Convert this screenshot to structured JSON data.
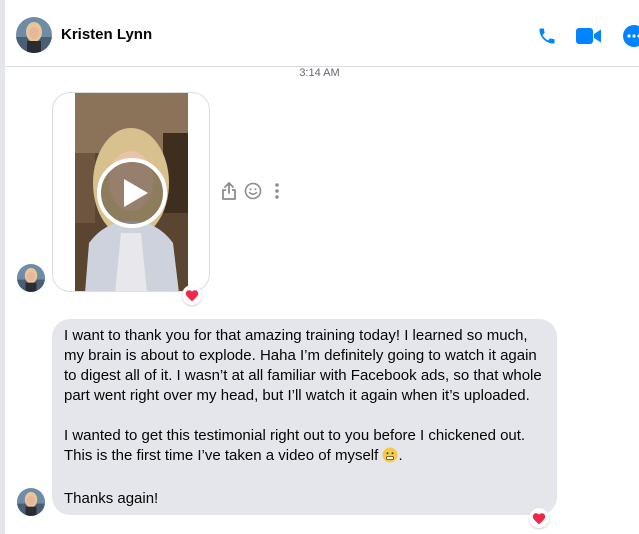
{
  "contact": {
    "name": "Kristen Lynn"
  },
  "header": {
    "actions": [
      {
        "name": "phone-icon"
      },
      {
        "name": "video-camera-icon"
      },
      {
        "name": "more-options-icon"
      }
    ]
  },
  "conversation": {
    "timestamp": "3:14 AM",
    "video_message": {
      "reaction": "heart"
    },
    "message_actions": [
      "share-icon",
      "emoji-reaction-icon",
      "more-vertical-icon"
    ],
    "text_message": {
      "paragraph1": "I want to thank you for that amazing training today! I learned so much, my brain is about to explode. Haha I’m definitely going to watch it again to digest all of it. I wasn’t at all familiar with Facebook ads, so that whole part went right over my head, but I’ll watch it again when it’s uploaded.",
      "paragraph2": "I wanted to get this testimonial right out to you before I chickened out. This is the first time I’ve taken a video of myself",
      "paragraph2_end": ".",
      "paragraph3": "Thanks again!",
      "reaction": "heart"
    }
  },
  "colors": {
    "accent": "#0084ff",
    "bubble_bg": "#e4e6eb",
    "heart": "#f02849",
    "timestamp": "#65676b"
  }
}
